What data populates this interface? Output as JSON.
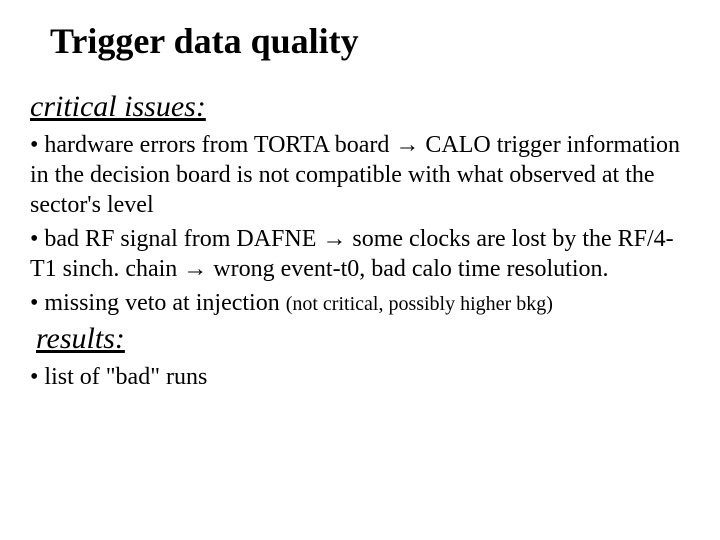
{
  "title": "Trigger data quality",
  "sections": {
    "critical": {
      "heading": "critical issues:",
      "bullet1": "•  hardware errors from  TORTA board → CALO trigger information in the decision board is not compatible with what observed at the sector's level",
      "bullet2": "•  bad RF signal from DAFNE  → some clocks are lost by the  RF/4-T1 sinch. chain →  wrong event-t0, bad calo time resolution.",
      "bullet3_main": "• missing veto at injection ",
      "bullet3_paren": "(not critical, possibly higher bkg)"
    },
    "results": {
      "heading": "results:",
      "bullet1": "• list of  \"bad\" runs"
    }
  }
}
